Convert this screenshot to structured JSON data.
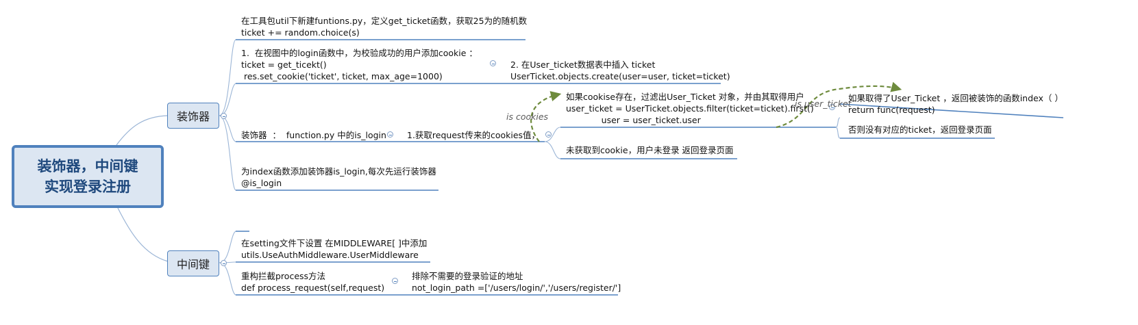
{
  "root": {
    "title": "装饰器，中间键\n实现登录注册"
  },
  "branches": {
    "decorator": {
      "label": "装饰器",
      "create_ticket": "在工具包util下新建funtions.py，定义get_ticket函数，获取25为的随机数\nticket += random.choice(s)",
      "login_view": "1.  在视图中的login函数中，为校验成功的用户添加cookie ：\nticket = get_ticekt()\n res.set_cookie('ticket', ticket, max_age=1000)",
      "insert_ticket": "2. 在User_ticket数据表中插入 ticket\nUserTicket.objects.create(user=user, ticket=ticket)",
      "is_login": "装饰器  ：  function.py 中的is_login",
      "get_cookies": "1.获取request传来的cookies值，",
      "cookie_exists": "如果cookise存在，过滤出User_Ticket 对象，并由其取得用户\nuser_ticket = UserTicket.objects.filter(ticket=ticket).first()\n             user = user_ticket.user",
      "ticket_found": "如果取得了User_Ticket ，返回被装饰的函数index（ ）\nreturn func(request)",
      "ticket_missing": "否则没有对应的ticket，返回登录页面",
      "no_cookie": "未获取到cookie，用户未登录 返回登录页面",
      "apply_decorator": "为index函数添加装饰器is_login,每次先运行装饰器\n@is_login"
    },
    "middleware": {
      "label": "中间键",
      "setting": "在setting文件下设置 在MIDDLEWARE[ ]中添加\nutils.UseAuthMiddleware.UserMiddleware",
      "process_request": "重构拦截process方法\ndef process_request(self,request)",
      "exclude_paths": "排除不需要的登录验证的地址\nnot_login_path =['/users/login/','/users/register/']"
    }
  },
  "relationships": {
    "is_cookies": "is cookies",
    "is_user_ticket": "is user_ticket"
  },
  "colors": {
    "root_fill": "#dce6f2",
    "root_border": "#4f81bd",
    "topic_line": "#4f81bd",
    "connector": "#9bb5d6",
    "relationship": "#6e8b3d"
  }
}
